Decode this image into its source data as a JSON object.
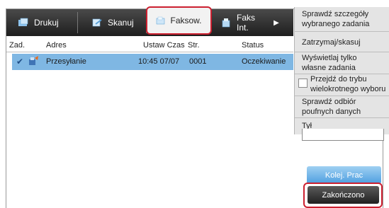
{
  "tabs": [
    {
      "label": "Drukuj",
      "icon": "print-icon"
    },
    {
      "label": "Skanuj",
      "icon": "scan-icon"
    },
    {
      "label": "Faksow.",
      "icon": "fax-icon",
      "active": true
    },
    {
      "label": "Faks Int.",
      "icon": "internet-fax-icon"
    }
  ],
  "more_tabs_icon": "play-right-icon",
  "columns": {
    "zad": "Zad.",
    "adres": "Adres",
    "ustaw_czas": "Ustaw Czas",
    "str": "Str.",
    "status": "Status"
  },
  "row": {
    "icon": "sending-icon",
    "adres": "Przesyłanie",
    "ustaw_czas": "10:45 07/07",
    "str": "0001",
    "status": "Oczekiwanie"
  },
  "menu": {
    "item1": [
      "Sprawdź szczegóły",
      "wybranego zadania"
    ],
    "item2": "Zatrzymaj/skasuj",
    "item3": [
      "Wyświetlaj tylko",
      "własne zadania"
    ],
    "item4": [
      "Przejdź do trybu",
      "wielokrotnego wyboru"
    ],
    "item5": [
      "Sprawdź odbiór",
      "poufnych danych"
    ],
    "item6": "Tył"
  },
  "buttons": {
    "kolej_prac": "Kolej. Prac",
    "zakonczono": "Zakończono"
  },
  "colors": {
    "highlight": "#cc2030",
    "row_selected": "#7fb7e3",
    "tab_bar": "#2a2a2a"
  }
}
